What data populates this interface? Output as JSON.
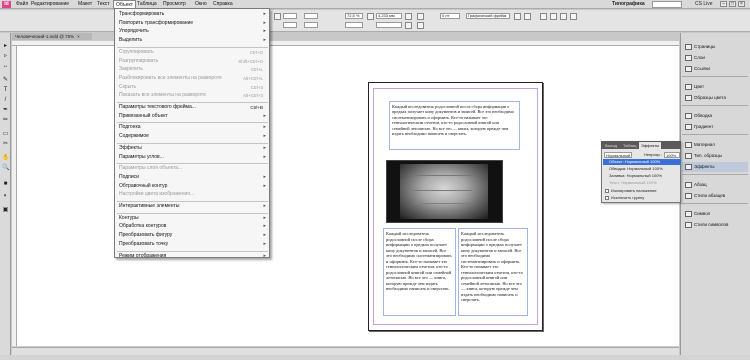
{
  "app": {
    "logo": "Id"
  },
  "menubar": {
    "items": [
      "Файл",
      "Редактирование",
      "Макет",
      "Текст",
      "Объект",
      "Таблица",
      "Просмотр",
      "Окно",
      "Справка"
    ],
    "workspace": "Типографика",
    "cs_live": "CS Live",
    "window_buttons": [
      "–",
      "□",
      "×"
    ]
  },
  "control": {
    "zoom": "72,5 %",
    "w": "4,233 мм",
    "font": "Графический фрейм",
    "stroke": "0 пт"
  },
  "document_tab": {
    "title": "Человеческий-1.indd @ 75%",
    "close": "×"
  },
  "tools": [
    "▸",
    "▹",
    "↔",
    "✎",
    "T",
    "/",
    "✒",
    "✏",
    "▭",
    "✂",
    "✋",
    "🔍",
    "■",
    "◐",
    "▣"
  ],
  "object_menu": {
    "items": [
      {
        "label": "Трансформировать",
        "sub": true
      },
      {
        "label": "Повторить трансформирование",
        "sub": true
      },
      {
        "label": "Упорядочить",
        "sub": true
      },
      {
        "label": "Выделить",
        "sub": true
      },
      {
        "label": "Сгруппировать",
        "shortcut": "Ctrl+G",
        "disabled": true,
        "sep_before": true
      },
      {
        "label": "Разгруппировать",
        "shortcut": "Shift+Ctrl+G",
        "disabled": true
      },
      {
        "label": "Закрепить",
        "shortcut": "Ctrl+L",
        "disabled": true
      },
      {
        "label": "Разблокировать все элементы на развороте",
        "shortcut": "Alt+Ctrl+L",
        "disabled": true
      },
      {
        "label": "Скрыть",
        "shortcut": "Ctrl+3",
        "disabled": true
      },
      {
        "label": "Показать все элементы на развороте",
        "shortcut": "Alt+Ctrl+3",
        "disabled": true
      },
      {
        "label": "Параметры текстового фрейма...",
        "shortcut": "Ctrl+B",
        "sep_before": true
      },
      {
        "label": "Привязанный объект",
        "sub": true
      },
      {
        "label": "Подгонка",
        "sub": true,
        "sep_before": true
      },
      {
        "label": "Содержимое",
        "sub": true
      },
      {
        "label": "Эффекты",
        "sub": true,
        "sep_before": true
      },
      {
        "label": "Параметры углов...",
        "sub": true
      },
      {
        "label": "Параметры слоя объекта...",
        "disabled": true,
        "sep_before": true
      },
      {
        "label": "Подписи",
        "sub": true
      },
      {
        "label": "Обтравочный контур",
        "sub": true
      },
      {
        "label": "Настройки цвета изображения...",
        "disabled": true
      },
      {
        "label": "Интерактивные элементы",
        "sub": true,
        "sep_before": true
      },
      {
        "label": "Контуры",
        "sub": true,
        "sep_before": true
      },
      {
        "label": "Обработка контуров",
        "sub": true
      },
      {
        "label": "Преобразовать фигуру",
        "sub": true
      },
      {
        "label": "Преобразовать точку",
        "sub": true
      },
      {
        "label": "Режим отображения",
        "sub": true,
        "sep_before": true
      }
    ]
  },
  "page": {
    "text_top": "Каждый исследователь родословной после сбора информации о предках получает кипу документов и записей. Все это необходимо систематизировать и оформить. Кто-то называет это генеалогическим отчетом, кто-то родословной книгой или семейной летописью. Но все это — книга, которую прежде чем издать необходимо написать и сверстать.",
    "text_col1": "Каждый исследователь родословной после сбора информации о предках получает кипу документов и записей. Все это необходимо систематизировать и оформить. Кто-то называет это генеалогическим отчетом, кто-то родословной книгой или семейной летописью. Но все это — книга, которую прежде чем издать необходимо написать и сверстать.",
    "text_col2": "Каждый исследователь родословной после сбора информации о предках получает кипу документов и записей. Все это необходимо систематизировать и оформить. Кто-то называет это генеалогическим отчетом, кто-то родословной книгой или семейной летописью. Но все это — книга, которую прежде чем издать необходимо написать и сверстать."
  },
  "panels": {
    "items": [
      {
        "label": "Страницы"
      },
      {
        "label": "Слои"
      },
      {
        "label": "Ссылки"
      },
      {
        "label": "Цвет"
      },
      {
        "label": "Образцы цвета"
      },
      {
        "label": "Обводка"
      },
      {
        "label": "Градиент"
      },
      {
        "label": "Материал"
      },
      {
        "label": "Тип. образцы"
      },
      {
        "label": "Эффекты",
        "selected": true
      },
      {
        "label": "Абзац"
      },
      {
        "label": "Стили абзацев"
      },
      {
        "label": "Символ"
      },
      {
        "label": "Стили символов"
      }
    ]
  },
  "effects_panel": {
    "tabs": [
      "Выход",
      "Таблиц",
      "Эффекты"
    ],
    "mode": "Нормальный",
    "opacity_label": "Непрозр.:",
    "opacity": "100%",
    "rows": [
      {
        "label": "Объект: Нормальный 100%",
        "selected": true
      },
      {
        "label": "Обводка: Нормальный 100%"
      },
      {
        "label": "Заливка: Нормальный 100%"
      },
      {
        "label": "Текст: Нормальный 100%",
        "disabled": true
      }
    ],
    "checks": [
      "Изолировать наложение",
      "Исключить группу"
    ]
  }
}
